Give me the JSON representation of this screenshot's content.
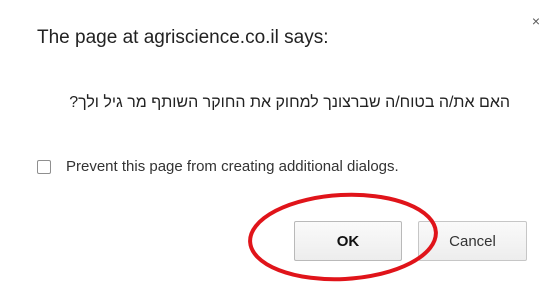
{
  "dialog": {
    "title": "The page at agriscience.co.il says:",
    "message": "האם את/ה בטוח/ה שברצונך למחוק את החוקר השותף מר גיל ולך?",
    "close_glyph": "×",
    "prevent_label": "Prevent this page from creating additional dialogs.",
    "prevent_checked": false,
    "ok_label": "OK",
    "cancel_label": "Cancel"
  },
  "annotation": {
    "color": "#e0141a",
    "shape": "ellipse"
  },
  "icons": {
    "close": "close-icon"
  }
}
